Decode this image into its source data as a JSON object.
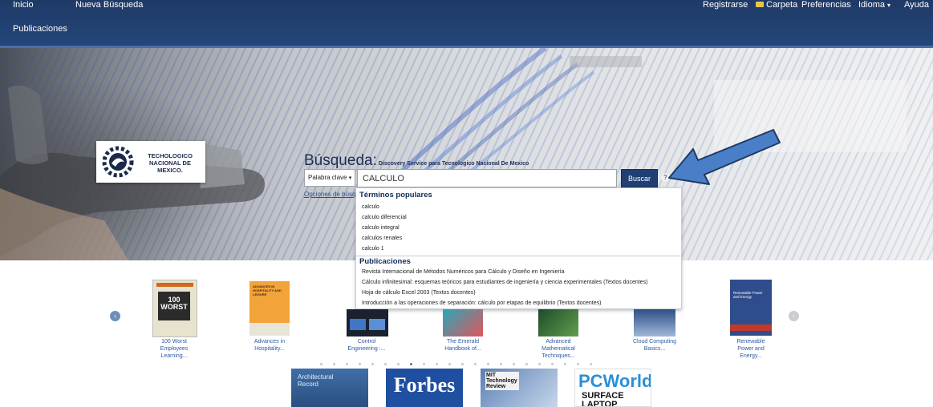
{
  "nav": {
    "inicio": "Inicio",
    "nueva_busqueda": "Nueva Búsqueda",
    "publicaciones": "Publicaciones",
    "registrarse": "Registrarse",
    "carpeta": "Carpeta",
    "preferencias": "Preferencias",
    "idioma": "Idioma",
    "ayuda": "Ayuda"
  },
  "logo": {
    "line1": "TECHOLOGICO",
    "line2": "NACIONAL DE MEXICO."
  },
  "search": {
    "title": "Búsqueda:",
    "subtitle": "Discovery Service para Tecnologico Nacional De Mexico",
    "field_select": "Palabra clave",
    "query": "CALCULO",
    "button": "Buscar",
    "help": "?",
    "options_link": "Opciones de búsqueda"
  },
  "dropdown": {
    "popular_header": "Términos populares",
    "popular": [
      "calculo",
      "calculo diferencial",
      "calculo integral",
      "calculos renales",
      "calculo 1"
    ],
    "pubs_header": "Publicaciones",
    "pubs": [
      "Revista Internacional de Métodos Numéricos para Cálculo y Diseño en Ingeniería",
      "Cálculo infinitesimal: esquemas teóricos para estudiantes de ingeniería y ciencia experimentales (Textos docentes)",
      "Hoja de cálculo Excel 2003 (Textos docentes)",
      "Introducción a las operaciones de separación:  cálculo por etapas de equilibrio (Textos docentes)"
    ]
  },
  "carousel": {
    "books": [
      {
        "l1": "100 Worst",
        "l2": "Employees",
        "l3": "Learning...",
        "cover": "100 WORST"
      },
      {
        "l1": "Advances in",
        "l2": "Hospitality...",
        "l3": "",
        "cover": "ADVANCES IN HOSPITALITY AND LEISURE"
      },
      {
        "l1": "Control",
        "l2": "Engineering :...",
        "l3": "",
        "cover": ""
      },
      {
        "l1": "The Emerald",
        "l2": "Handbook of...",
        "l3": "",
        "cover": ""
      },
      {
        "l1": "Advanced",
        "l2": "Mathematical",
        "l3": "Techniques...",
        "cover": ""
      },
      {
        "l1": "Cloud Computing",
        "l2": "Basics...",
        "l3": "",
        "cover": ""
      },
      {
        "l1": "Renewable",
        "l2": "Power and",
        "l3": "Energy...",
        "cover": "Renewable Power and Energy"
      }
    ],
    "prev_glyph": "‹",
    "next_glyph": "›"
  },
  "magazines": [
    {
      "title": "Architectural Record"
    },
    {
      "title": "Forbes"
    },
    {
      "title": "MIT Technology Review"
    },
    {
      "title": "PCWorld",
      "subtitle": "SURFACE LAPTOP"
    }
  ],
  "colors": {
    "nav_bg": "#1f3a66",
    "button_bg": "#1f3f75",
    "link": "#2a58a8",
    "arrow": "#4a7fc8"
  }
}
